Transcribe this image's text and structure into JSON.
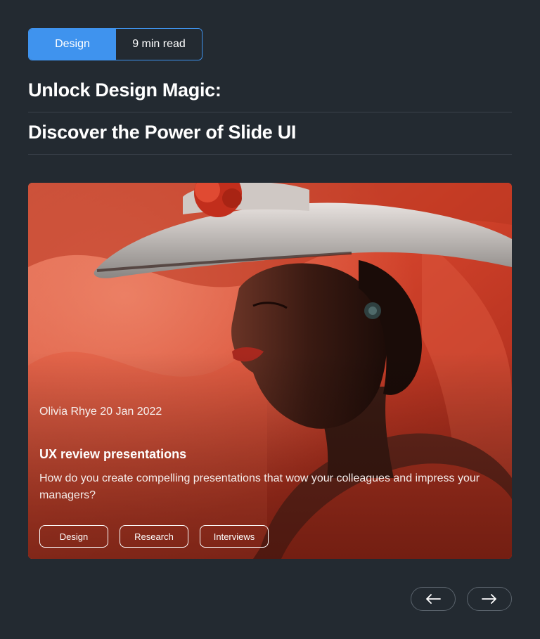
{
  "badge": {
    "category": "Design",
    "read_time": "9 min read"
  },
  "headline": {
    "line1": "Unlock Design Magic:",
    "line2": "Discover the Power of Slide UI"
  },
  "card": {
    "meta": "Olivia Rhye 20 Jan 2022",
    "title": "UX review presentations",
    "description": "How do you create compelling presentations that wow your colleagues and impress your managers?",
    "tags": [
      "Design",
      "Research",
      "Interviews"
    ],
    "image_subject": "woman-in-red-hat-portrait"
  },
  "pager": {
    "prev_icon": "arrow-left-icon",
    "next_icon": "arrow-right-icon"
  },
  "colors": {
    "background": "#232a31",
    "accent": "#3f93ee",
    "card_red": "#c23a25"
  }
}
